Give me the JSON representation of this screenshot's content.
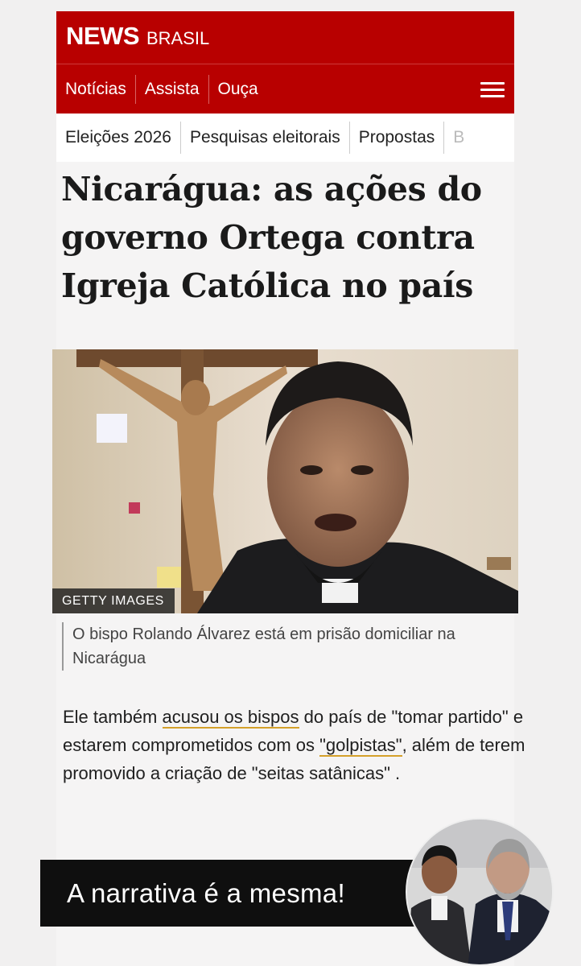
{
  "masthead": {
    "brand_news": "NEWS",
    "brand_brasil": "BRASIL"
  },
  "nav": {
    "items": [
      "Notícias",
      "Assista",
      "Ouça"
    ],
    "menu_icon": "hamburger-menu-icon"
  },
  "subnav": {
    "items": [
      "Eleições 2026",
      "Pesquisas eleitorais",
      "Propostas",
      "B"
    ]
  },
  "article": {
    "headline": "Nicarágua: as ações do governo Ortega contra Igreja Católica no país",
    "photo_credit": "GETTY IMAGES",
    "caption": "O bispo Rolando Álvarez está em prisão domiciliar na Nicarágua",
    "body_parts": [
      "Ele também ",
      "acusou os bispos",
      " do país de \"tomar partido\" e estarem comprometidos com os ",
      "\"golpistas\"",
      ", além de terem promovido a criação de \"seitas satânicas\" ."
    ]
  },
  "overlay": {
    "banner_text": "A narrativa é a mesma!"
  },
  "colors": {
    "brand_red": "#b80000",
    "highlight_underline": "#d4a02a",
    "banner_bg": "#0f0f0f"
  }
}
